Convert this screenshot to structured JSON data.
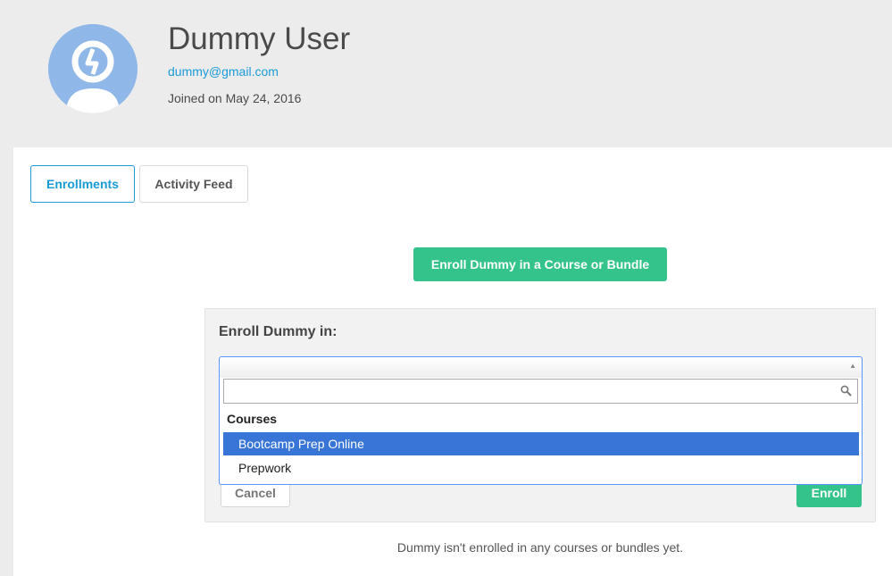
{
  "user": {
    "name": "Dummy User",
    "email": "dummy@gmail.com",
    "joined": "Joined on May 24, 2016"
  },
  "tabs": [
    {
      "label": "Enrollments",
      "active": true
    },
    {
      "label": "Activity Feed",
      "active": false
    }
  ],
  "enroll_cta_label": "Enroll Dummy in a Course or Bundle",
  "enroll_form": {
    "title": "Enroll Dummy in:",
    "selected_value": "",
    "search_value": "",
    "group_label": "Courses",
    "options": [
      {
        "label": "Bootcamp Prep Online",
        "highlighted": true
      },
      {
        "label": "Prepwork",
        "highlighted": false
      }
    ],
    "cancel_label": "Cancel",
    "enroll_label": "Enroll"
  },
  "empty_message": "Dummy isn't enrolled in any courses or bundles yet.",
  "colors": {
    "accent": "#1a9bd7",
    "primary_button": "#34c48b",
    "highlight": "#3875d7",
    "avatar": "#8fb8e8"
  }
}
